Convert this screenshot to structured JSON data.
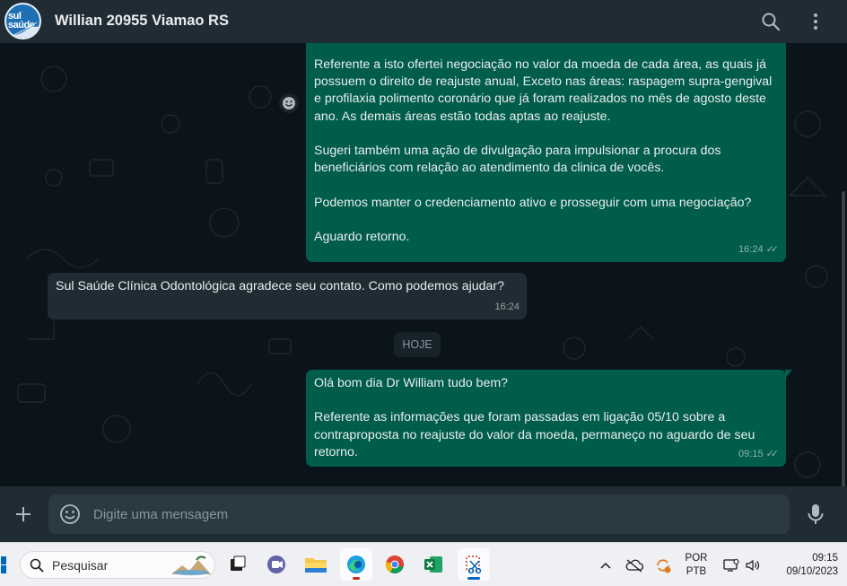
{
  "header": {
    "avatar_text": "sul saúde",
    "contact_name": "Willian 20955 Viamao RS",
    "search_icon": "search-icon",
    "menu_icon": "kebab-menu-icon"
  },
  "messages": {
    "m1": {
      "paragraphs": [
        "Referente a isto ofertei negociação no valor da moeda de cada área, as quais já possuem o direito de reajuste anual, Exceto nas áreas: raspagem supra-gengival e profilaxia polimento coronário que já foram realizados no mês de agosto deste ano. As demais áreas estão todas aptas ao reajuste.",
        "",
        "Sugeri também uma ação de divulgação para impulsionar a procura dos beneficiários com relação ao atendimento da clinica de vocês.",
        "",
        "Podemos manter o credenciamento ativo e prosseguir com uma negociação?",
        "",
        "Aguardo retorno."
      ],
      "time": "16:24"
    },
    "m2": {
      "text": "Sul Saúde Clínica Odontológica agradece seu contato. Como podemos ajudar?",
      "time": "16:24"
    },
    "date_divider": "HOJE",
    "m3": {
      "paragraphs": [
        "Olá bom dia Dr William tudo bem?",
        "",
        "Referente as informações que foram passadas em ligação 05/10 sobre a contraproposta no reajuste do valor da moeda, permaneço no aguardo de seu retorno."
      ],
      "time": "09:15"
    },
    "tick_glyph": "✓✓"
  },
  "composer": {
    "placeholder": "Digite uma mensagem",
    "attach_icon": "plus-icon",
    "emoji_icon": "emoji-icon",
    "mic_icon": "microphone-icon"
  },
  "taskbar": {
    "search_placeholder": "Pesquisar",
    "lang_line1": "POR",
    "lang_line2": "PTB",
    "time": "09:15",
    "date": "09/10/2023"
  },
  "colors": {
    "outgoing_bubble": "#005c4b",
    "incoming_bubble": "#202c33",
    "chat_bg": "#0b141a",
    "header_bg": "#202c33"
  }
}
